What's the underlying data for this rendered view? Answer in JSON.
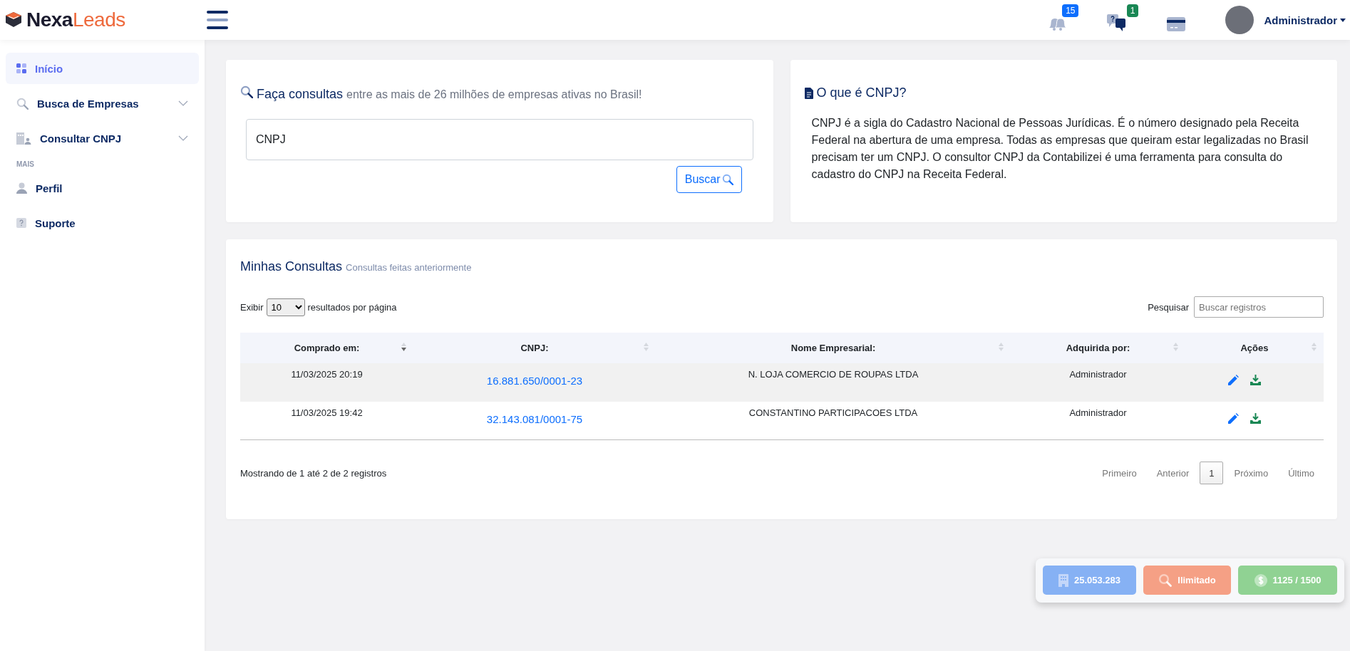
{
  "brand": {
    "first": "Nexa",
    "second": "Leads"
  },
  "header": {
    "notifications": [
      {
        "kind": "bell",
        "count": "15",
        "color": "#0d6efd"
      },
      {
        "kind": "chat",
        "count": "1",
        "color": "#198754"
      },
      {
        "kind": "card"
      }
    ],
    "user": {
      "name": "Administrador"
    }
  },
  "sidebar": {
    "items": [
      {
        "kind": "link",
        "label": "Início",
        "selected": true
      },
      {
        "kind": "menu",
        "label": "Busca de Empresas",
        "selected": false
      },
      {
        "kind": "menu",
        "label": "Consultar CNPJ",
        "selected": false
      },
      {
        "kind": "section",
        "label": "MAIS"
      },
      {
        "kind": "link",
        "label": "Perfil",
        "selected": false
      },
      {
        "kind": "link",
        "label": "Suporte",
        "selected": false
      }
    ]
  },
  "search_card": {
    "title": "Faça consultas",
    "subtitle": "entre as mais de 26 milhões de empresas ativas no Brasil!",
    "field": {
      "placeholder": "CNPJ"
    },
    "button": "Buscar"
  },
  "info_card": {
    "title": "O que é CNPJ?",
    "text": "CNPJ é a sigla do Cadastro Nacional de Pessoas Jurídicas. É o número designado pela Receita Federal na abertura de uma empresa. Todas as empresas que queiram estar legalizadas no Brasil precisam ter um CNPJ. O consultor CNPJ da Contabilizei é uma ferramenta para consulta do cadastro do CNPJ na Receita Federal."
  },
  "consults": {
    "title": "Minhas Consultas",
    "subtitle": "Consultas feitas anteriormente",
    "length": {
      "before": "Exibir",
      "value": "10",
      "after": "resultados por página"
    },
    "search": {
      "label": "Pesquisar",
      "placeholder": "Buscar registros"
    },
    "table": {
      "columns": [
        {
          "label": "Comprado em:",
          "sorted": true
        },
        {
          "label": "CNPJ:",
          "sorted": false
        },
        {
          "label": "Nome Empresarial:",
          "sorted": false
        },
        {
          "label": "Adquirida por:",
          "sorted": false
        },
        {
          "label": "Ações",
          "sorted": false
        }
      ],
      "rows": [
        {
          "date": "11/03/2025 20:19",
          "cnpj": "16.881.650/0001-23",
          "name": "N. LOJA COMERCIO DE ROUPAS LTDA",
          "buyer": "Administrador"
        },
        {
          "date": "11/03/2025 19:42",
          "cnpj": "32.143.081/0001-75",
          "name": "CONSTANTINO PARTICIPACOES LTDA",
          "buyer": "Administrador"
        }
      ]
    },
    "info": "Mostrando de 1 até 2 de 2 registros",
    "pagination": [
      {
        "label": "Primeiro",
        "selected": false
      },
      {
        "label": "Anterior",
        "selected": false
      },
      {
        "label": "1",
        "selected": true
      },
      {
        "label": "Próximo",
        "selected": false
      },
      {
        "label": "Último",
        "selected": false
      }
    ]
  },
  "stats": [
    {
      "kind": "companies",
      "value": "25.053.283",
      "color": "#86b1f4"
    },
    {
      "kind": "searches",
      "value": "Ilimitado",
      "color": "#f5a085"
    },
    {
      "kind": "credits",
      "value": "1125 / 1500",
      "color": "#90d293"
    }
  ]
}
